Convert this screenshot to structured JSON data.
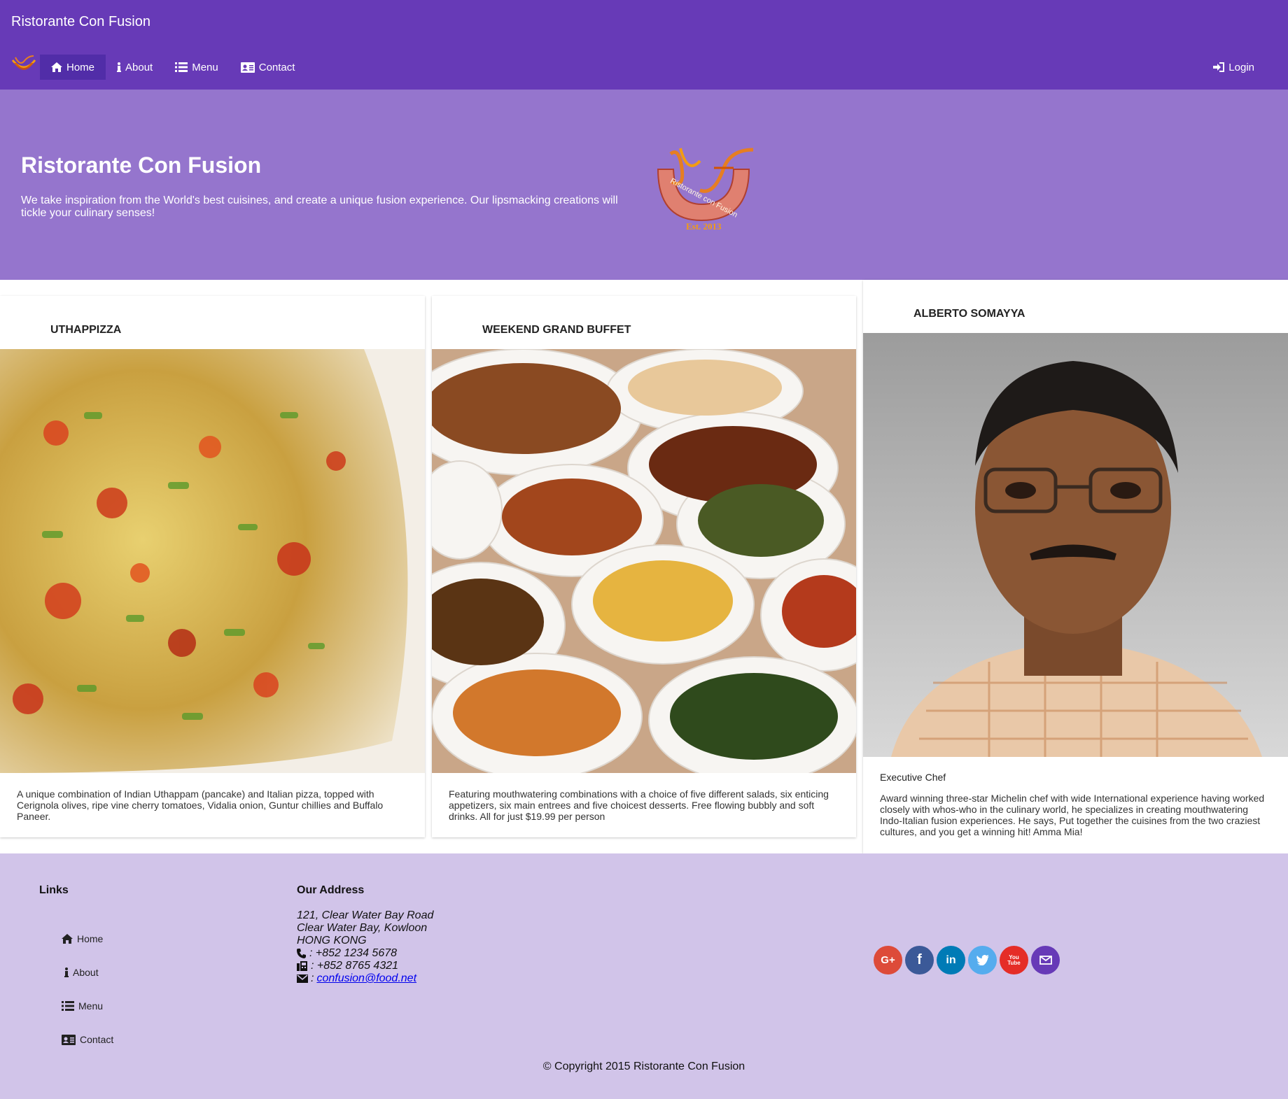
{
  "navbar": {
    "brand": "Ristorante Con Fusion",
    "items": [
      {
        "label": "Home",
        "icon": "home-icon",
        "active": true
      },
      {
        "label": "About",
        "icon": "info-icon"
      },
      {
        "label": "Menu",
        "icon": "list-icon"
      },
      {
        "label": "Contact",
        "icon": "address-card-icon"
      }
    ],
    "login": "Login"
  },
  "jumbotron": {
    "title": "Ristorante Con Fusion",
    "text": "We take inspiration from the World's best cuisines, and create a unique fusion experience. Our lipsmacking creations will tickle your culinary senses!",
    "logo_text": "Ristorante con Fusion",
    "logo_est": "Est. 2013"
  },
  "cards": [
    {
      "title": "UTHAPPIZZA",
      "image": "pizza-photo",
      "text": "A unique combination of Indian Uthappam (pancake) and Italian pizza, topped with Cerignola olives, ripe vine cherry tomatoes, Vidalia onion, Guntur chillies and Buffalo Paneer."
    },
    {
      "title": "WEEKEND GRAND BUFFET",
      "image": "buffet-photo",
      "text": "Featuring mouthwatering combinations with a choice of five different salads, six enticing appetizers, six main entrees and five choicest desserts. Free flowing bubbly and soft drinks. All for just $19.99 per person"
    },
    {
      "title": "ALBERTO SOMAYYA",
      "image": "chef-photo",
      "subtitle": "Executive Chef",
      "text": "Award winning three-star Michelin chef with wide International experience having worked closely with whos-who in the culinary world, he specializes in creating mouthwatering Indo-Italian fusion experiences. He says, Put together the cuisines from the two craziest cultures, and you get a winning hit! Amma Mia!"
    }
  ],
  "footer": {
    "links_title": "Links",
    "links": [
      "Home",
      "About",
      "Menu",
      "Contact"
    ],
    "address_title": "Our Address",
    "address_lines": [
      "121, Clear Water Bay Road",
      "Clear Water Bay, Kowloon",
      "HONG KONG"
    ],
    "phone": ": +852 1234 5678",
    "fax": ": +852 8765 4321",
    "email_prefix": ":",
    "email": "confusion@food.net",
    "socials": [
      {
        "name": "google-plus-icon",
        "label": "G+",
        "color": "#dd4b39"
      },
      {
        "name": "facebook-icon",
        "label": "f",
        "color": "#3b5998"
      },
      {
        "name": "linkedin-icon",
        "label": "in",
        "color": "#007bb6"
      },
      {
        "name": "twitter-icon",
        "label": "t",
        "color": "#55acee"
      },
      {
        "name": "youtube-icon",
        "label": "You Tube",
        "color": "#e52d27"
      },
      {
        "name": "email-icon",
        "label": "✉",
        "color": "#673ab7"
      }
    ],
    "copyright": "© Copyright 2015 Ristorante Con Fusion"
  }
}
